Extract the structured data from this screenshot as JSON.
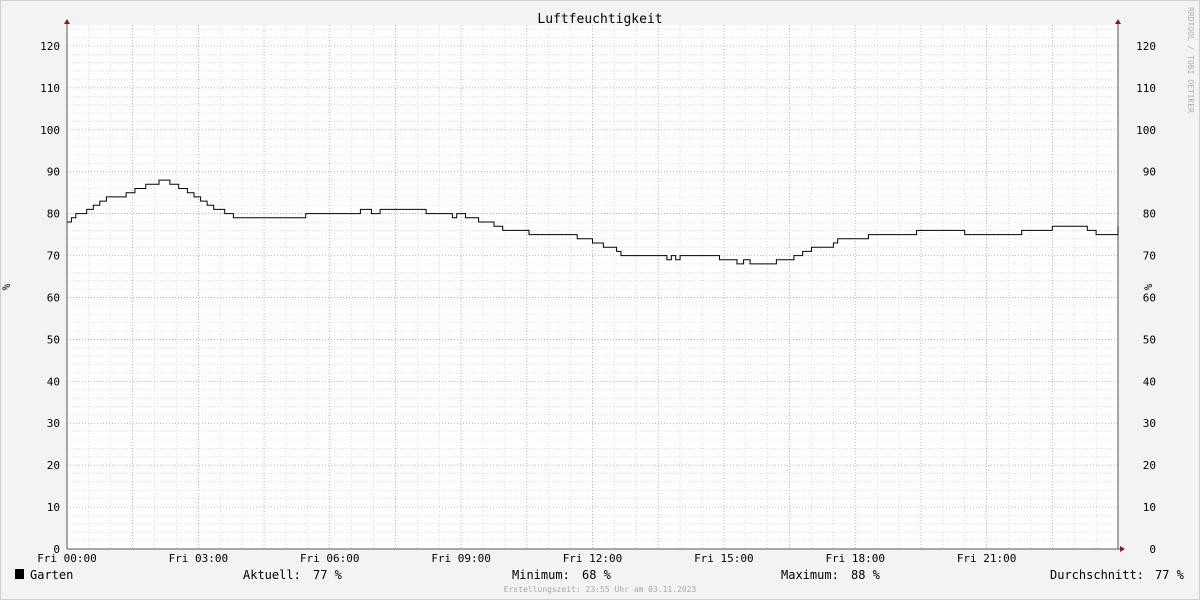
{
  "chart_data": {
    "type": "line",
    "title": "Luftfeuchtigkeit",
    "ylabel": "%",
    "ylim": [
      0,
      125
    ],
    "y_ticks": [
      0,
      10,
      20,
      30,
      40,
      50,
      60,
      70,
      80,
      90,
      100,
      110,
      120
    ],
    "x_tick_labels": [
      "Fri 00:00",
      "Fri 03:00",
      "Fri 06:00",
      "Fri 09:00",
      "Fri 12:00",
      "Fri 15:00",
      "Fri 18:00",
      "Fri 21:00"
    ],
    "x_range_hours": [
      0,
      24
    ],
    "grid": true,
    "watermark": "RRDTOOL / TOBI OETIKER",
    "series": [
      {
        "name": "Garten",
        "color": "#000000",
        "hours": [
          0.0,
          0.1,
          0.2,
          0.3,
          0.45,
          0.6,
          0.75,
          0.9,
          1.1,
          1.35,
          1.55,
          1.8,
          2.0,
          2.1,
          2.2,
          2.35,
          2.55,
          2.75,
          2.9,
          3.05,
          3.2,
          3.35,
          3.6,
          3.8,
          4.4,
          5.0,
          5.45,
          6.0,
          6.6,
          6.7,
          6.95,
          7.0,
          7.15,
          7.4,
          8.0,
          8.2,
          8.5,
          8.8,
          8.9,
          9.0,
          9.1,
          9.4,
          9.75,
          9.95,
          10.2,
          10.55,
          11.0,
          11.5,
          11.65,
          12.0,
          12.25,
          12.45,
          12.55,
          12.65,
          12.75,
          13.0,
          13.5,
          13.7,
          13.8,
          13.9,
          14.0,
          14.3,
          14.6,
          14.9,
          15.1,
          15.3,
          15.45,
          15.6,
          15.85,
          16.2,
          16.4,
          16.6,
          16.8,
          17.0,
          17.3,
          17.5,
          17.6,
          18.0,
          18.3,
          18.8,
          19.4,
          20.0,
          20.5,
          21.3,
          21.8,
          22.5,
          23.0,
          23.3,
          23.5,
          23.7,
          23.85,
          24.0
        ],
        "values": [
          78,
          79,
          80,
          80,
          81,
          82,
          83,
          84,
          84,
          85,
          86,
          87,
          87,
          88,
          88,
          87,
          86,
          85,
          84,
          83,
          82,
          81,
          80,
          79,
          79,
          79,
          80,
          80,
          80,
          81,
          80,
          80,
          81,
          81,
          81,
          80,
          80,
          79,
          80,
          80,
          79,
          78,
          77,
          76,
          76,
          75,
          75,
          75,
          74,
          73,
          72,
          72,
          71,
          70,
          70,
          70,
          70,
          69,
          70,
          69,
          70,
          70,
          70,
          69,
          69,
          68,
          69,
          68,
          68,
          69,
          69,
          70,
          71,
          72,
          72,
          73,
          74,
          74,
          75,
          75,
          76,
          76,
          75,
          75,
          76,
          77,
          77,
          76,
          75,
          75,
          75,
          77
        ]
      }
    ]
  },
  "legend": {
    "series_name": "Garten",
    "aktuell_label": "Aktuell:",
    "aktuell_value": "77 %",
    "minimum_label": "Minimum:",
    "minimum_value": "68 %",
    "maximum_label": "Maximum:",
    "maximum_value": "88 %",
    "avg_label": "Durchschnitt:",
    "avg_value": "77 %"
  },
  "footer": "Erstellungszeit: 23:55 Uhr am 03.11.2023",
  "colors": {
    "background": "#f3f3f3",
    "canvas": "#ffffff",
    "major_grid": "#e08080",
    "minor_grid": "#c8c8c8",
    "line": "#000000",
    "arrow": "#8b1a1a"
  }
}
